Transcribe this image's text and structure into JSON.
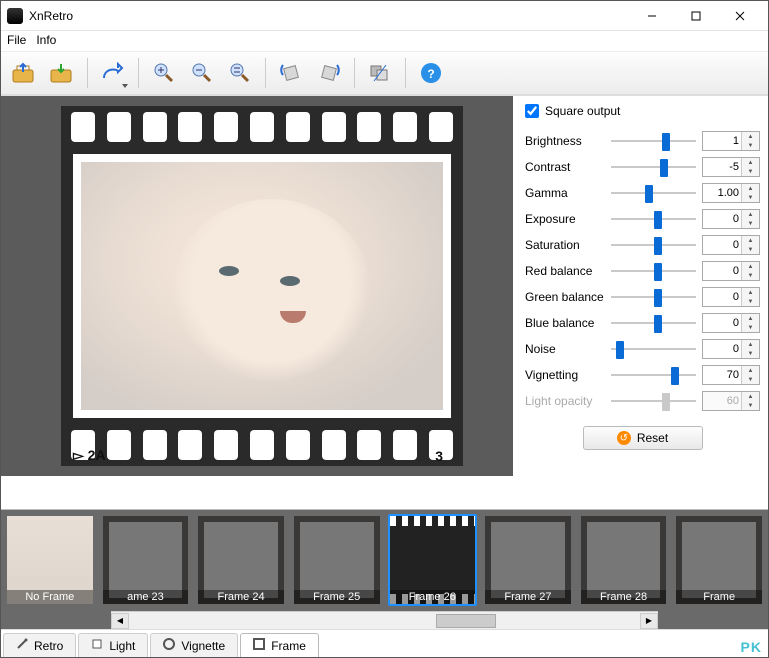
{
  "window": {
    "title": "XnRetro",
    "menu": [
      "File",
      "Info"
    ]
  },
  "toolbar": {
    "open": "open-icon",
    "save": "save-icon",
    "share": "share-icon",
    "zoom_in": "zoom-in-icon",
    "zoom_out": "zoom-out-icon",
    "zoom_reset": "zoom-reset-icon",
    "rotate_left": "rotate-left-icon",
    "rotate_right": "rotate-right-icon",
    "compare": "compare-icon",
    "help": "help-icon"
  },
  "filmstrip": {
    "marker_left": "▻ 2A",
    "marker_right": "3"
  },
  "controls": {
    "square_output_label": "Square output",
    "square_output_checked": true,
    "rows": [
      {
        "label": "Brightness",
        "value": "1",
        "pos": 60
      },
      {
        "label": "Contrast",
        "value": "-5",
        "pos": 58
      },
      {
        "label": "Gamma",
        "value": "1.00",
        "pos": 40
      },
      {
        "label": "Exposure",
        "value": "0",
        "pos": 50
      },
      {
        "label": "Saturation",
        "value": "0",
        "pos": 50
      },
      {
        "label": "Red balance",
        "value": "0",
        "pos": 50
      },
      {
        "label": "Green balance",
        "value": "0",
        "pos": 50
      },
      {
        "label": "Blue balance",
        "value": "0",
        "pos": 50
      },
      {
        "label": "Noise",
        "value": "0",
        "pos": 6
      },
      {
        "label": "Vignetting",
        "value": "70",
        "pos": 70
      }
    ],
    "light_row": {
      "label": "Light opacity",
      "value": "60",
      "pos": 60,
      "disabled": true
    },
    "reset_label": "Reset"
  },
  "frames": {
    "items": [
      {
        "label": "No Frame",
        "kind": "noframe"
      },
      {
        "label": "ame 23",
        "kind": "border"
      },
      {
        "label": "Frame 24",
        "kind": "border"
      },
      {
        "label": "Frame 25",
        "kind": "border"
      },
      {
        "label": "Frame 26",
        "kind": "film",
        "selected": true
      },
      {
        "label": "Frame 27",
        "kind": "border"
      },
      {
        "label": "Frame 28",
        "kind": "border"
      },
      {
        "label": "Frame",
        "kind": "border"
      }
    ]
  },
  "tabs": {
    "items": [
      {
        "label": "Retro",
        "icon": "wand-icon"
      },
      {
        "label": "Light",
        "icon": "light-icon"
      },
      {
        "label": "Vignette",
        "icon": "vignette-icon"
      },
      {
        "label": "Frame",
        "icon": "frame-icon",
        "active": true
      }
    ]
  },
  "watermark": "PK"
}
